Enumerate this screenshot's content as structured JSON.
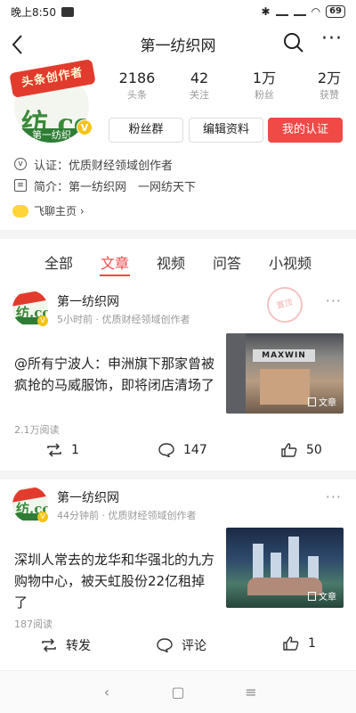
{
  "status_bar": {
    "time": "晚上8:50",
    "battery": "69"
  },
  "nav": {
    "title": "第一纺织网"
  },
  "profile": {
    "avatar_badge": "头条创作者",
    "avatar_logo": "纺.co",
    "avatar_sub": "第一纺织",
    "verified_mark": "V",
    "stats": [
      {
        "num": "2186",
        "label": "头条"
      },
      {
        "num": "42",
        "label": "关注"
      },
      {
        "num": "1万",
        "label": "粉丝"
      },
      {
        "num": "2万",
        "label": "获赞"
      }
    ],
    "buttons": {
      "fans_group": "粉丝群",
      "edit_profile": "编辑资料",
      "my_cert": "我的认证"
    },
    "cert_label": "认证：",
    "cert_text": "优质财经领域创作者",
    "intro_label": "简介：",
    "intro_text": "第一纺织网　一网纺天下",
    "feiliao": "飞聊主页 ›"
  },
  "tabs": [
    "全部",
    "文章",
    "视频",
    "问答",
    "小视频"
  ],
  "active_tab": 1,
  "feed": [
    {
      "author": "第一纺织网",
      "meta": "5小时前 · 优质财经领域创作者",
      "stamp": "置顶",
      "headline": "@所有宁波人：申洲旗下那家曾被疯抢的马威服饰，即将闭店清场了",
      "thumb_sign": "MAXWIN",
      "thumb_tag": "文章",
      "reads": "2.1万阅读",
      "share": "1",
      "comments": "147",
      "likes": "50"
    },
    {
      "author": "第一纺织网",
      "meta": "44分钟前 · 优质财经领域创作者",
      "headline": "深圳人常去的龙华和华强北的九方购物中心，被天虹股份22亿租掉了",
      "thumb_tag": "文章",
      "reads": "187阅读",
      "share": "转发",
      "comments": "评论",
      "likes": "1"
    }
  ],
  "sys_nav": {
    "back": "‹",
    "home": "▢",
    "menu": "≡"
  }
}
